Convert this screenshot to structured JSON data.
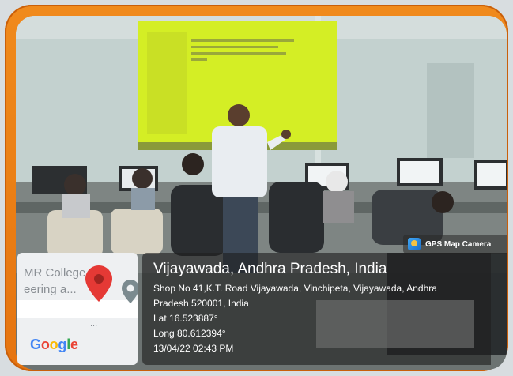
{
  "gps_badge": {
    "label": "GPS Map Camera",
    "icon": "gps-map-camera-icon"
  },
  "map": {
    "label_line1": "MR College",
    "label_line2": "eering a...",
    "dots": "...",
    "logo": [
      "G",
      "o",
      "o",
      "g",
      "l",
      "e"
    ]
  },
  "location": {
    "title": "Vijayawada, Andhra Pradesh, India",
    "address_line1": "Shop No 41,K.T. Road Vijayawada, Vinchipeta, Vijayawada, Andhra",
    "address_line2": "Pradesh 520001, India",
    "lat": "Lat 16.523887°",
    "long": "Long 80.612394°",
    "datetime": "13/04/22 02:43 PM"
  },
  "colors": {
    "frame": "#f08a1c",
    "projection": "#d4ee25",
    "pin_red": "#e53935",
    "pin_grey": "#7b8a8f"
  }
}
